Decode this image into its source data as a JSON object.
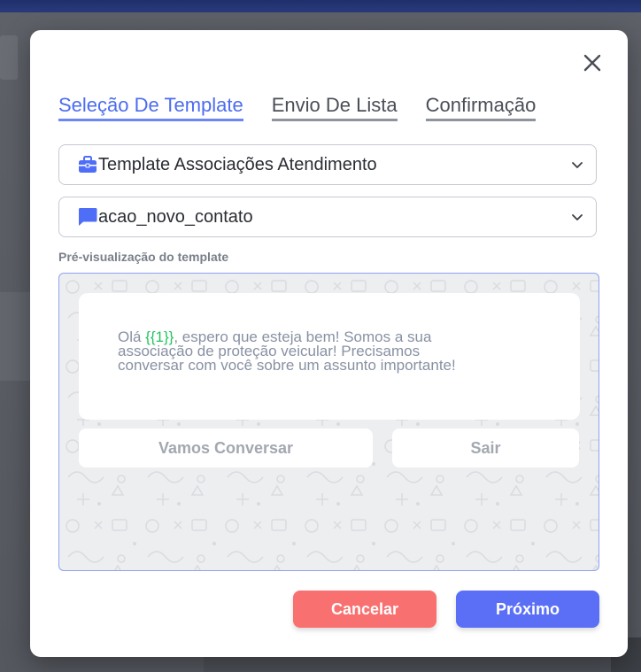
{
  "tabs": [
    {
      "label": "Seleção De Template",
      "active": true
    },
    {
      "label": "Envio De Lista",
      "active": false
    },
    {
      "label": "Confirmação",
      "active": false
    }
  ],
  "template_select": {
    "value": "Template Associações Atendimento",
    "icon": "briefcase-icon"
  },
  "message_select": {
    "value": "acao_novo_contato",
    "icon": "chat-bubble-icon"
  },
  "preview": {
    "label": "Pré-visualização do template",
    "message_prefix": "Olá ",
    "message_variable": "{{1}}",
    "message_line1": ", espero que esteja bem! Somos a sua",
    "message_line2": "associação de proteção veicular! Precisamos",
    "message_line3": "conversar com você sobre um assunto importante!",
    "quick_replies": [
      "Vamos Conversar",
      "Sair"
    ]
  },
  "footer": {
    "cancel_label": "Cancelar",
    "next_label": "Próximo"
  },
  "colors": {
    "accent": "#4c6cf0",
    "cancel": "#f87070",
    "next": "#5a6ff6",
    "variable": "#22c55e",
    "icon_blue": "#4f6ef7"
  }
}
